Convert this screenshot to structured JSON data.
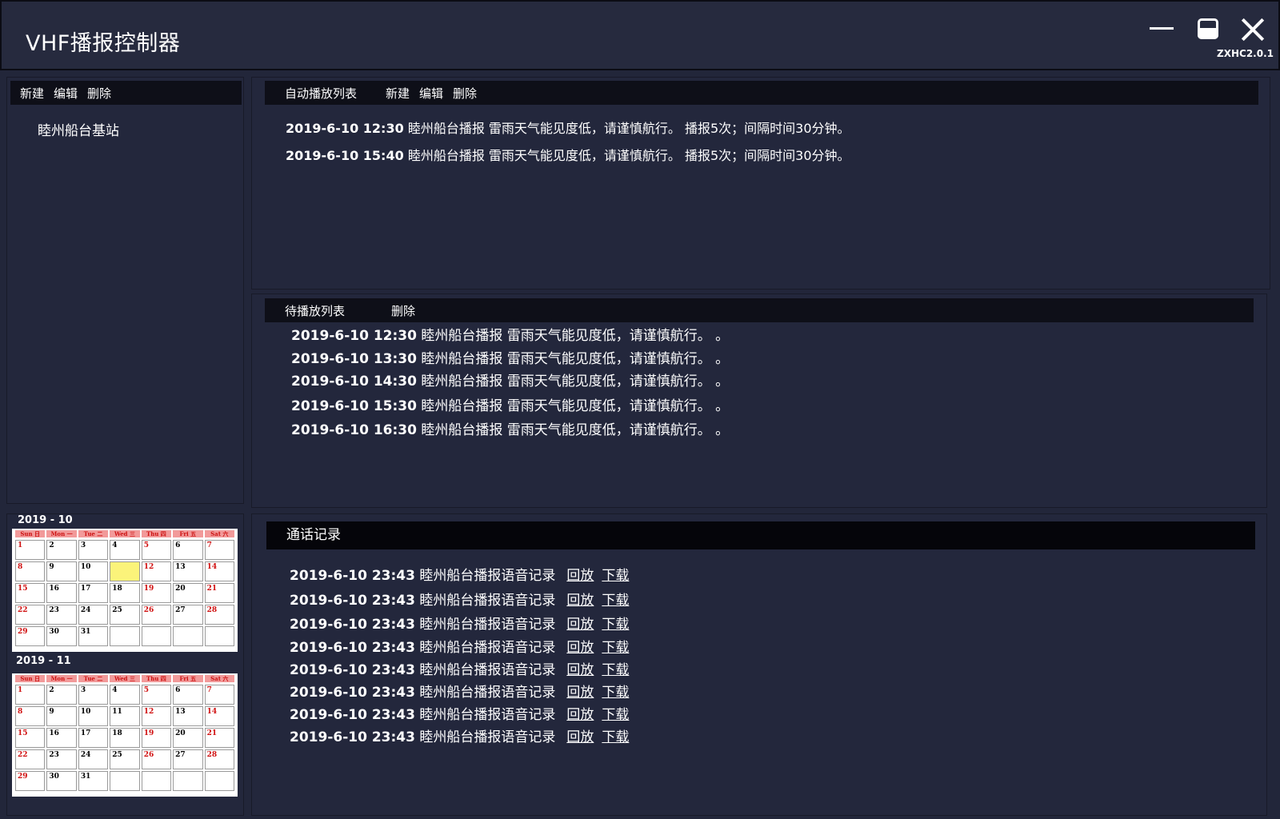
{
  "window": {
    "title": "VHF播报控制器",
    "version": "ZXHC2.0.1"
  },
  "station_panel": {
    "toolbar": [
      "新建",
      "编辑",
      "删除"
    ],
    "stations": [
      "睦州船台基站"
    ]
  },
  "auto_list": {
    "title": "自动播放列表",
    "toolbar": [
      "新建",
      "编辑",
      "删除"
    ],
    "items": [
      {
        "time": "2019-6-10 12:30",
        "text": "睦州船台播报  雷雨天气能见度低，请谨慎航行。  播报5次；间隔时间30分钟。"
      },
      {
        "time": "2019-6-10 15:40",
        "text": "睦州船台播报  雷雨天气能见度低，请谨慎航行。  播报5次；间隔时间30分钟。"
      }
    ]
  },
  "pending_list": {
    "title": "待播放列表",
    "toolbar": [
      "删除"
    ],
    "items": [
      {
        "time": "2019-6-10 12:30",
        "text": "睦州船台播报  雷雨天气能见度低，请谨慎航行。 。"
      },
      {
        "time": "2019-6-10 13:30",
        "text": "睦州船台播报  雷雨天气能见度低，请谨慎航行。 。"
      },
      {
        "time": "2019-6-10 14:30",
        "text": "睦州船台播报  雷雨天气能见度低，请谨慎航行。 。"
      },
      {
        "time": "2019-6-10 15:30",
        "text": "睦州船台播报  雷雨天气能见度低，请谨慎航行。 。"
      },
      {
        "time": "2019-6-10 16:30",
        "text": "睦州船台播报  雷雨天气能见度低，请谨慎航行。 。"
      }
    ]
  },
  "calendars": [
    {
      "title": "2019 - 10",
      "weekdays": [
        "Sun 日",
        "Mon 一",
        "Tue 二",
        "Wed 三",
        "Thu 四",
        "Fri 五",
        "Sat 六"
      ],
      "days": [
        "1",
        "2",
        "3",
        "4",
        "5",
        "6",
        "7",
        "8",
        "9",
        "10",
        "",
        "12",
        "13",
        "14",
        "15",
        "16",
        "17",
        "18",
        "19",
        "20",
        "21",
        "22",
        "23",
        "24",
        "25",
        "26",
        "27",
        "28",
        "29",
        "30",
        "31",
        "",
        "",
        "",
        ""
      ],
      "selected_index": 10
    },
    {
      "title": "2019 - 11",
      "weekdays": [
        "Sun 日",
        "Mon 一",
        "Tue 二",
        "Wed 三",
        "Thu 四",
        "Fri 五",
        "Sat 六"
      ],
      "days": [
        "1",
        "2",
        "3",
        "4",
        "5",
        "6",
        "7",
        "8",
        "9",
        "10",
        "11",
        "12",
        "13",
        "14",
        "15",
        "16",
        "17",
        "18",
        "19",
        "20",
        "21",
        "22",
        "23",
        "24",
        "25",
        "26",
        "27",
        "28",
        "29",
        "30",
        "31",
        "",
        "",
        "",
        ""
      ],
      "selected_index": -1
    }
  ],
  "call_log": {
    "title": "通话记录",
    "items": [
      {
        "time": "2019-6-10 23:43",
        "text": "睦州船台播报语音记录",
        "replay": "回放",
        "download": "下载"
      },
      {
        "time": "2019-6-10 23:43",
        "text": "睦州船台播报语音记录",
        "replay": "回放",
        "download": "下载"
      },
      {
        "time": "2019-6-10 23:43",
        "text": "睦州船台播报语音记录",
        "replay": "回放",
        "download": "下载"
      },
      {
        "time": "2019-6-10 23:43",
        "text": "睦州船台播报语音记录",
        "replay": "回放",
        "download": "下载"
      },
      {
        "time": "2019-6-10 23:43",
        "text": "睦州船台播报语音记录",
        "replay": "回放",
        "download": "下载"
      },
      {
        "time": "2019-6-10 23:43",
        "text": "睦州船台播报语音记录",
        "replay": "回放",
        "download": "下载"
      },
      {
        "time": "2019-6-10 23:43",
        "text": "睦州船台播报语音记录",
        "replay": "回放",
        "download": "下载"
      },
      {
        "time": "2019-6-10 23:43",
        "text": "睦州船台播报语音记录",
        "replay": "回放",
        "download": "下载"
      }
    ]
  }
}
